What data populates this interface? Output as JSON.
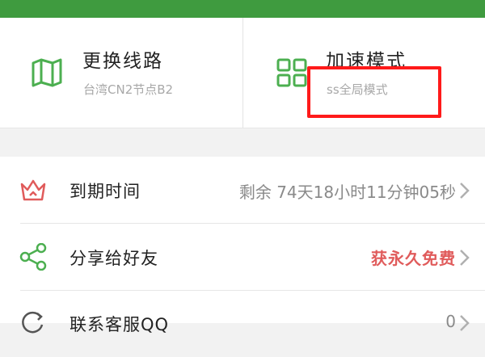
{
  "colors": {
    "brand_green": "#3f9b3f",
    "icon_green": "#4caf50",
    "accent_red": "#e05b5b",
    "highlight_red": "#ff1a1a"
  },
  "cards": [
    {
      "title": "更换线路",
      "subtitle": "台湾CN2节点B2",
      "icon": "map-icon"
    },
    {
      "title": "加速模式",
      "subtitle": "ss全局模式",
      "icon": "grid-icon"
    }
  ],
  "list": [
    {
      "label": "到期时间",
      "value": "剩余 74天18小时11分钟05秒",
      "icon": "crown-icon"
    },
    {
      "label": "分享给好友",
      "value": "获永久免费",
      "icon": "share-icon"
    },
    {
      "label": "联系客服QQ",
      "value": "0",
      "icon": "refresh-icon"
    }
  ]
}
